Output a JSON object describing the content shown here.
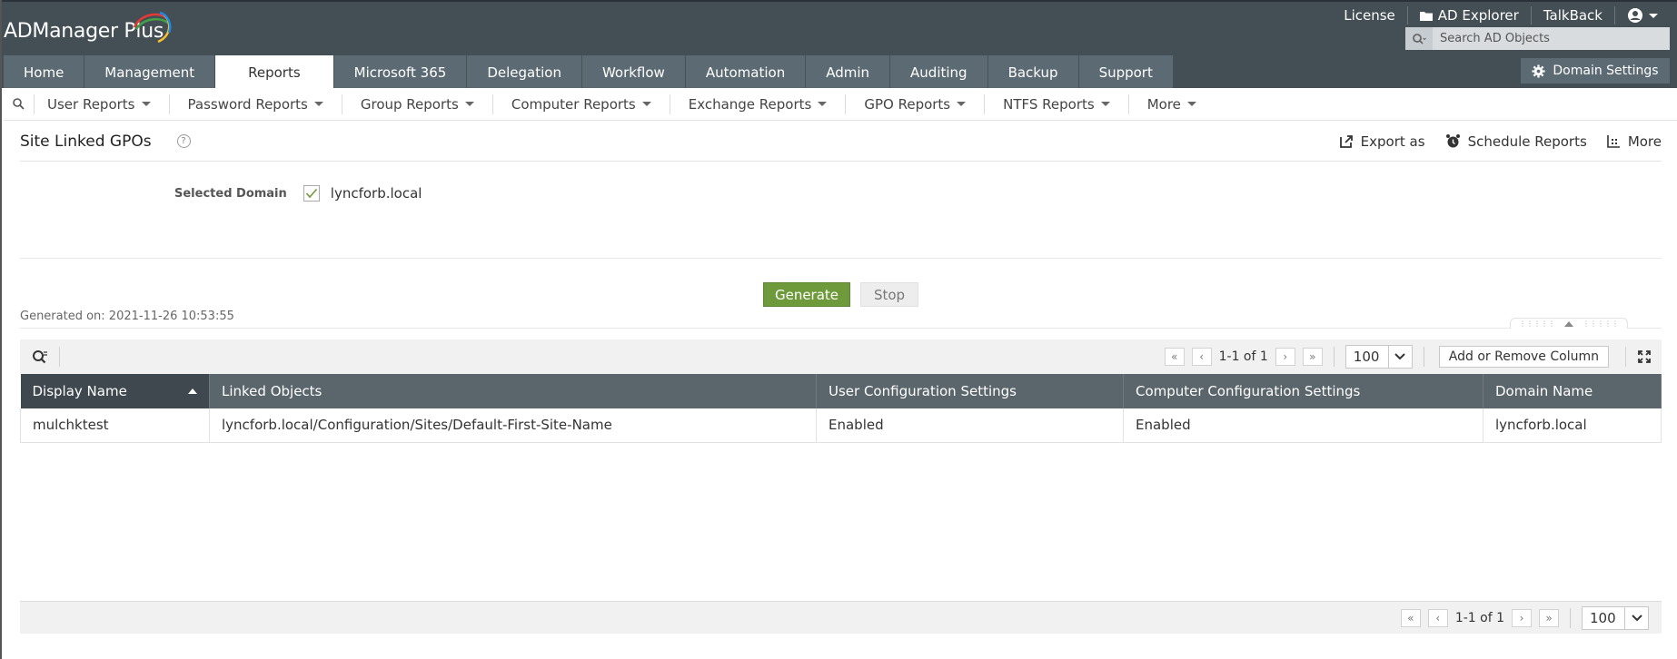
{
  "header": {
    "logo_text": "ADManager Plus",
    "top_links": [
      {
        "label": "License",
        "icon": ""
      },
      {
        "label": "AD Explorer",
        "icon": "folder-icon"
      },
      {
        "label": "TalkBack",
        "icon": ""
      }
    ],
    "search_placeholder": "Search AD Objects",
    "domain_settings_label": "Domain Settings"
  },
  "tabs": [
    {
      "label": "Home",
      "active": false
    },
    {
      "label": "Management",
      "active": false
    },
    {
      "label": "Reports",
      "active": true
    },
    {
      "label": "Microsoft 365",
      "active": false
    },
    {
      "label": "Delegation",
      "active": false
    },
    {
      "label": "Workflow",
      "active": false
    },
    {
      "label": "Automation",
      "active": false
    },
    {
      "label": "Admin",
      "active": false
    },
    {
      "label": "Auditing",
      "active": false
    },
    {
      "label": "Backup",
      "active": false
    },
    {
      "label": "Support",
      "active": false
    }
  ],
  "subnav": [
    {
      "label": "User Reports"
    },
    {
      "label": "Password Reports"
    },
    {
      "label": "Group Reports"
    },
    {
      "label": "Computer Reports"
    },
    {
      "label": "Exchange Reports"
    },
    {
      "label": "GPO Reports"
    },
    {
      "label": "NTFS Reports"
    },
    {
      "label": "More"
    }
  ],
  "page": {
    "title": "Site Linked GPOs",
    "help_glyph": "?",
    "actions": [
      {
        "label": "Export as",
        "icon": "export-icon"
      },
      {
        "label": "Schedule Reports",
        "icon": "alarm-clock-icon"
      },
      {
        "label": "More",
        "icon": "more-grid-icon"
      }
    ],
    "selected_domain_label": "Selected Domain",
    "selected_domain_value": "lyncforb.local",
    "generate_label": "Generate",
    "stop_label": "Stop",
    "generated_on": "Generated on: 2021-11-26 10:53:55"
  },
  "grid": {
    "pager_text": "1-1 of 1",
    "page_size": "100",
    "add_remove_label": "Add or Remove Column",
    "columns": [
      "Display Name",
      "Linked Objects",
      "User Configuration Settings",
      "Computer Configuration Settings",
      "Domain Name"
    ],
    "rows": [
      [
        "mulchktest",
        "lyncforb.local/Configuration/Sites/Default-First-Site-Name",
        "Enabled",
        "Enabled",
        "lyncforb.local"
      ]
    ]
  },
  "colors": {
    "header_bg": "#444e55",
    "tab_bg": "#5c6a73",
    "generate_green": "#6f9a3b",
    "table_header": "#5a656c"
  }
}
